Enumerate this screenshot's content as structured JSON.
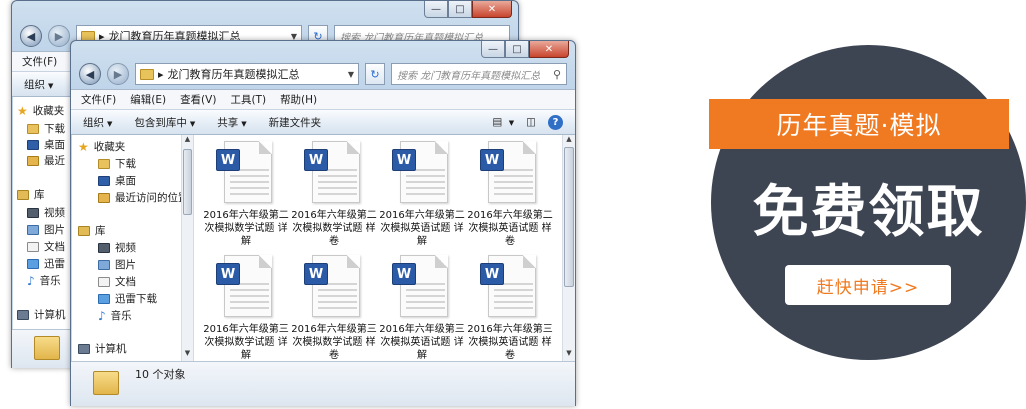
{
  "back_window": {
    "title": "龙门教育历年真题模拟汇总",
    "search_placeholder": "搜索 龙门教育历年真题模拟汇总",
    "menu": [
      "文件(F)",
      "编"
    ],
    "cmd": "组织",
    "nav": [
      "收藏夹",
      "下载",
      "桌面",
      "最近",
      "库",
      "视频",
      "图片",
      "文档",
      "迅雷",
      "音乐",
      "计算机"
    ]
  },
  "front_window": {
    "title": "龙门教育历年真题模拟汇总",
    "search_placeholder": "搜索 龙门教育历年真题模拟汇总",
    "menu": [
      "文件(F)",
      "编辑(E)",
      "查看(V)",
      "工具(T)",
      "帮助(H)"
    ],
    "commands": [
      "组织",
      "包含到库中",
      "共享",
      "新建文件夹"
    ],
    "nav": {
      "favorites": "收藏夹",
      "downloads": "下载",
      "desktop": "桌面",
      "recent": "最近访问的位置",
      "libraries": "库",
      "videos": "视频",
      "pictures": "图片",
      "documents": "文档",
      "thunder": "迅雷下载",
      "music": "音乐",
      "computer": "计算机"
    },
    "files": [
      {
        "badge": "W",
        "name": "2016年六年级第二次模拟数学试题 详解"
      },
      {
        "badge": "W",
        "name": "2016年六年级第二次模拟数学试题 样卷"
      },
      {
        "badge": "W",
        "name": "2016年六年级第二次模拟英语试题 详解"
      },
      {
        "badge": "W",
        "name": "2016年六年级第二次模拟英语试题 样卷"
      },
      {
        "badge": "W",
        "name": "2016年六年级第三次模拟数学试题 详解"
      },
      {
        "badge": "W",
        "name": "2016年六年级第三次模拟数学试题 样卷"
      },
      {
        "badge": "W",
        "name": "2016年六年级第三次模拟英语试题 详解"
      },
      {
        "badge": "W",
        "name": "2016年六年级第三次模拟英语试题 样卷"
      }
    ],
    "status": "10 个对象"
  },
  "promo": {
    "banner": "历年真题·模拟",
    "headline": "免费领取",
    "cta": "赶快申请>>",
    "colors": {
      "circle": "#3d4452",
      "accent": "#f07a21"
    }
  }
}
